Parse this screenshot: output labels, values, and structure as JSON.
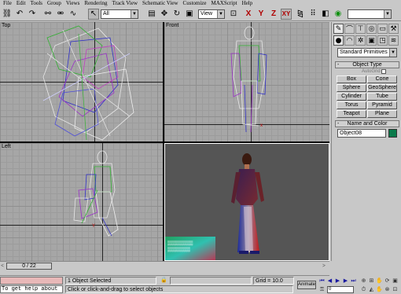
{
  "menu": [
    "File",
    "Edit",
    "Tools",
    "Group",
    "Views",
    "Rendering",
    "Track View",
    "Schematic View",
    "Customize",
    "MAXScript",
    "Help"
  ],
  "toolbar": {
    "selection_filter": "All",
    "reference_coord": "View",
    "axis_x": "X",
    "axis_y": "Y",
    "axis_z": "Z",
    "axis_xy": "XY",
    "named_selection": ""
  },
  "viewports": {
    "top": "Top",
    "front": "Front",
    "left": "Left"
  },
  "command_panel": {
    "category_dropdown": "Standard Primitives",
    "object_type_header": "Object Type",
    "autogrid_label": "AutoGrid",
    "buttons": [
      "Box",
      "Cone",
      "Sphere",
      "GeoSphere",
      "Cylinder",
      "Tube",
      "Torus",
      "Pyramid",
      "Teapot",
      "Plane"
    ],
    "name_color_header": "Name and Color",
    "object_name": "Object08",
    "object_color": "#0a7a4a"
  },
  "time_slider": {
    "frame_label": "0 / 22"
  },
  "status_bar": {
    "help_prompt": "To get help about load",
    "selection_status": "1 Object Selected",
    "prompt": "Click or click-and-drag to select objects",
    "grid": "Grid = 10.0",
    "animate_label": "Animate",
    "frame_field": "0"
  }
}
